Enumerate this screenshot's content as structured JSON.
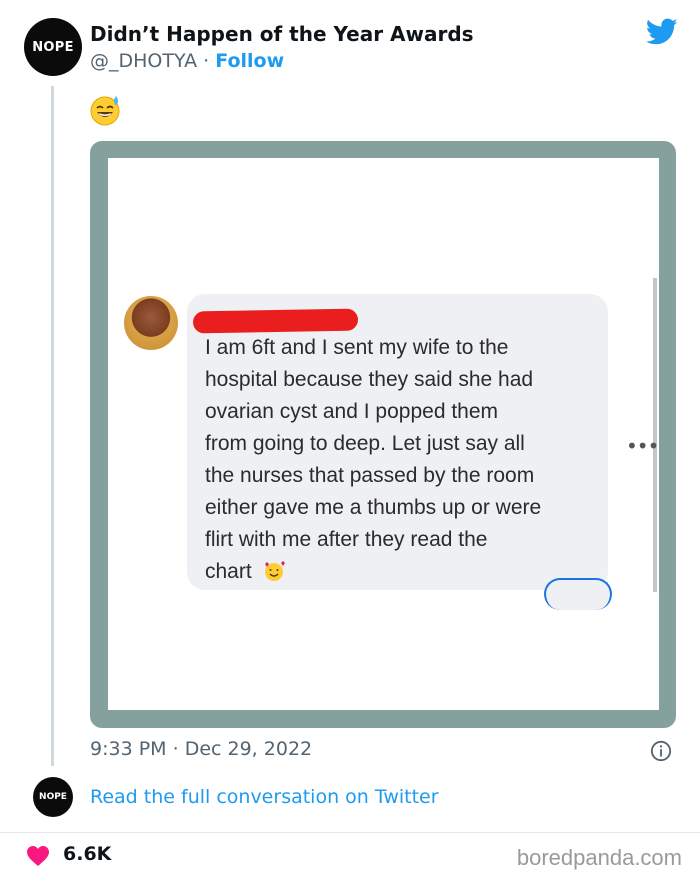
{
  "author": {
    "avatar_text": "NOPE",
    "name": "Didn’t Happen of the Year Awards",
    "handle": "@_DHOTYA",
    "separator": "·",
    "follow_label": "Follow"
  },
  "tweet": {
    "emoji": "sweat-smile-emoji",
    "embedded_post": {
      "lines": [
        "I am 6ft and I sent my wife to the",
        "hospital because they said she had",
        "ovarian cyst and I popped them",
        "from going to deep. Let just say all",
        "the nurses that passed by the room",
        "either gave me a thumbs up or were",
        "flirt with me after they read the",
        "chart"
      ],
      "more_label": "•••"
    },
    "time": "9:33 PM",
    "date_separator": "·",
    "date": "Dec 29, 2022"
  },
  "footer": {
    "small_avatar_text": "NOPE",
    "read_link": "Read the full conversation on Twitter",
    "likes": "6.6K",
    "brand": "boredpanda.com"
  },
  "colors": {
    "accent": "#1d9bf0",
    "frame": "#84a19d",
    "heart": "#f91880",
    "redaction": "#ea1e1e"
  }
}
